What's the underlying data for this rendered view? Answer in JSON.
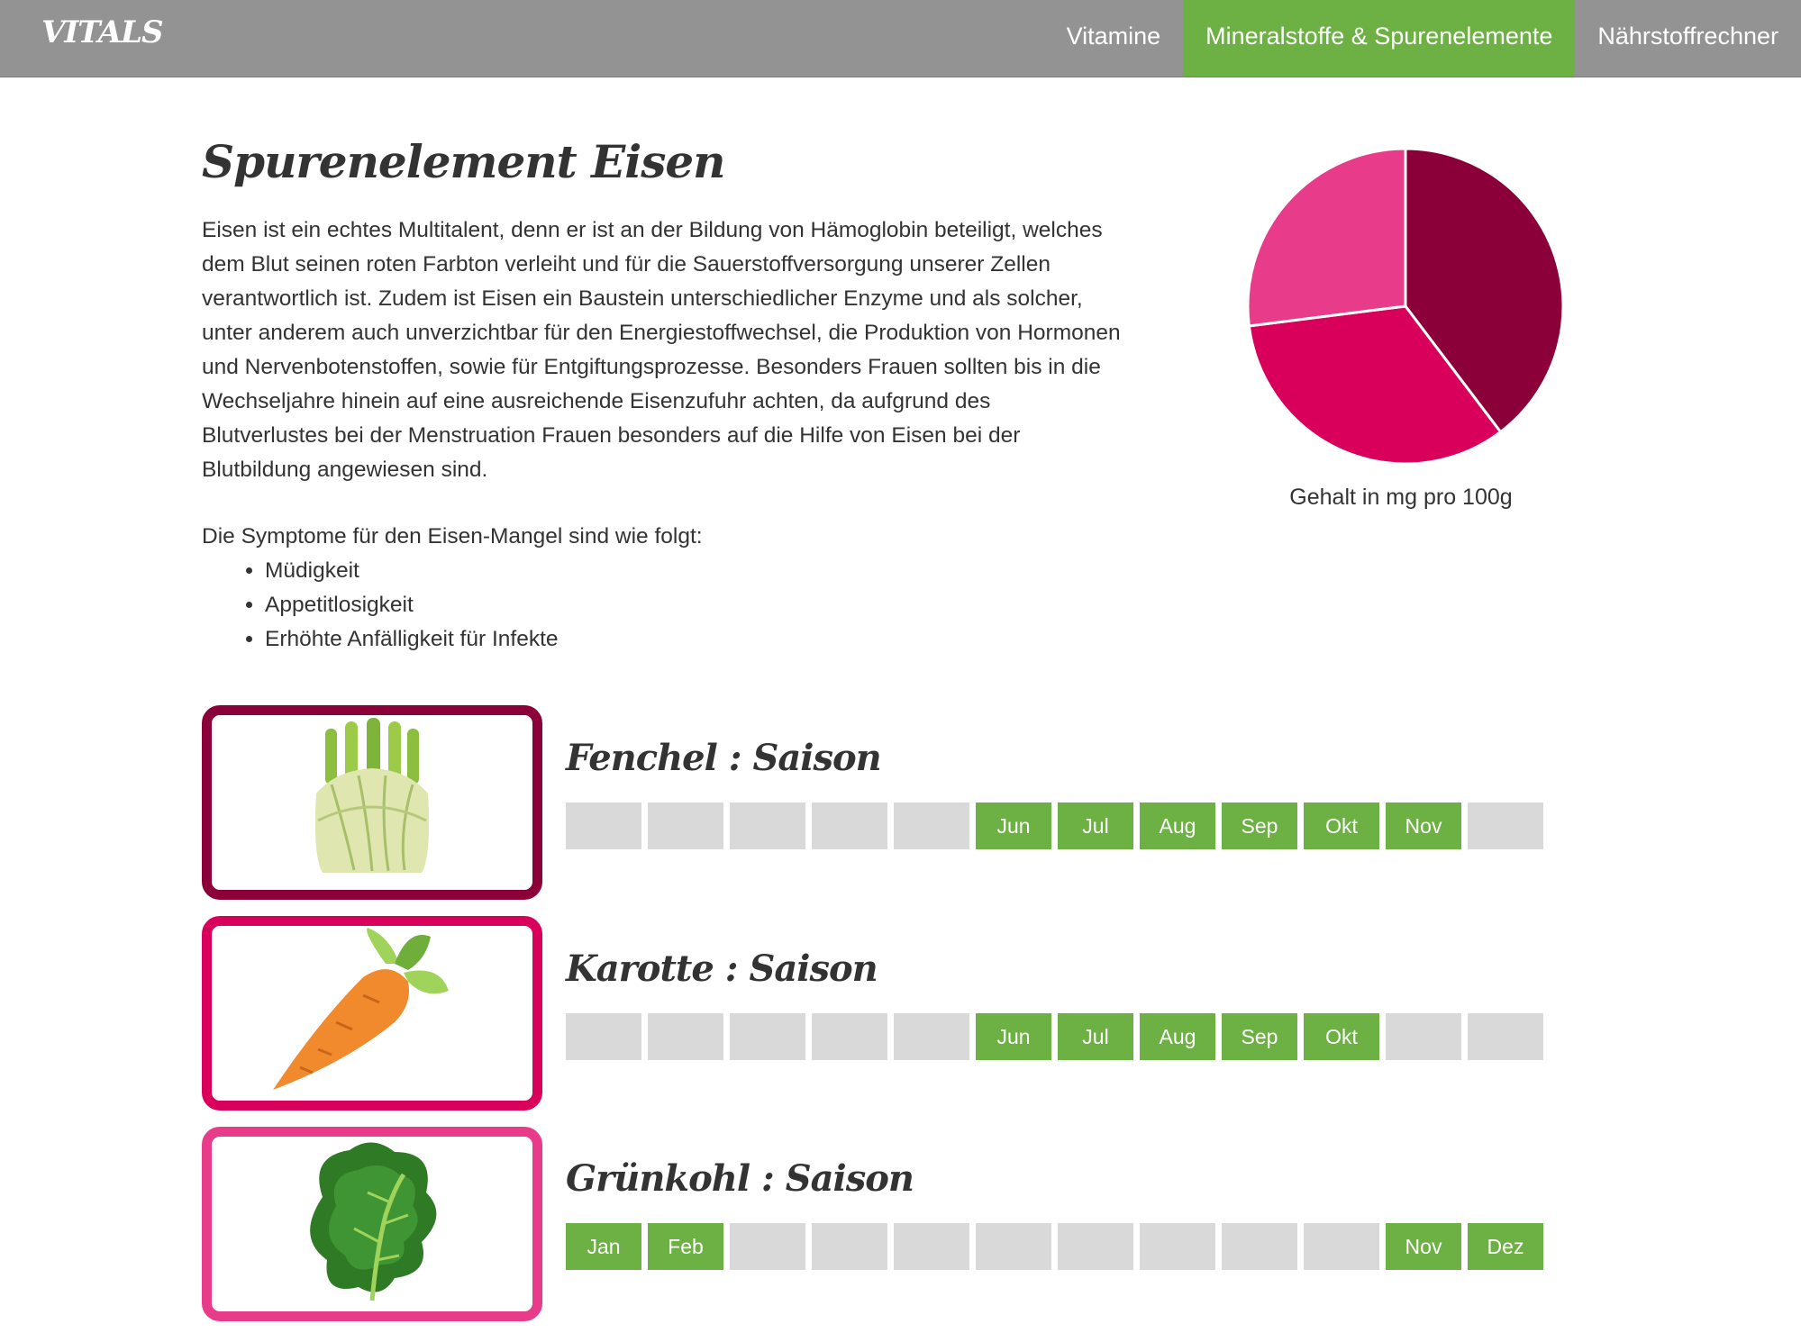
{
  "header": {
    "brand": "VITALS",
    "nav": [
      {
        "label": "Vitamine"
      },
      {
        "label": "Mineralstoffe & Spurenelemente",
        "active": true
      },
      {
        "label": "Nährstoffrechner"
      }
    ]
  },
  "page": {
    "title": "Spurenelement Eisen",
    "intro": "Eisen ist ein echtes Multitalent, denn er ist an der Bildung von Hämoglobin beteiligt, welches dem Blut seinen roten Farbton verleiht und für die Sauerstoffversorgung unserer Zellen verantwortlich ist. Zudem ist Eisen ein Baustein unterschiedlicher Enzyme und als solcher, unter anderem auch unverzichtbar für den Energiestoffwechsel, die Produktion von Hormonen und Nervenbotenstoffen, sowie für Entgiftungsprozesse. Besonders Frauen sollten bis in die Wechseljahre hinein auf eine ausreichende Eisenzufuhr achten, da aufgrund des Blutverlustes bei der Menstruation Frauen besonders auf die Hilfe von Eisen bei der Blutbildung angewiesen sind.",
    "symptoms_intro": "Die Symptome für den Eisen-Mangel sind wie folgt:",
    "symptoms": [
      "Müdigkeit",
      "Appetitlosigkeit",
      "Erhöhte Anfälligkeit für Infekte"
    ]
  },
  "chart_data": {
    "type": "pie",
    "caption": "Gehalt in mg pro 100g",
    "slices": [
      {
        "share": 0.397,
        "color": "#8b0038"
      },
      {
        "share": 0.333,
        "color": "#d8005a"
      },
      {
        "share": 0.27,
        "color": "#e83c8a"
      }
    ]
  },
  "foods": [
    {
      "name": "Fenchel",
      "title": "Fenchel : Saison",
      "color": "#8b0038",
      "icon": "fennel-icon",
      "months": [
        {
          "label": "",
          "in_season": false
        },
        {
          "label": "",
          "in_season": false
        },
        {
          "label": "",
          "in_season": false
        },
        {
          "label": "",
          "in_season": false
        },
        {
          "label": "",
          "in_season": false
        },
        {
          "label": "Jun",
          "in_season": true
        },
        {
          "label": "Jul",
          "in_season": true
        },
        {
          "label": "Aug",
          "in_season": true
        },
        {
          "label": "Sep",
          "in_season": true
        },
        {
          "label": "Okt",
          "in_season": true
        },
        {
          "label": "Nov",
          "in_season": true
        },
        {
          "label": "",
          "in_season": false
        }
      ]
    },
    {
      "name": "Karotte",
      "title": "Karotte : Saison",
      "color": "#d8005a",
      "icon": "carrot-icon",
      "months": [
        {
          "label": "",
          "in_season": false
        },
        {
          "label": "",
          "in_season": false
        },
        {
          "label": "",
          "in_season": false
        },
        {
          "label": "",
          "in_season": false
        },
        {
          "label": "",
          "in_season": false
        },
        {
          "label": "Jun",
          "in_season": true
        },
        {
          "label": "Jul",
          "in_season": true
        },
        {
          "label": "Aug",
          "in_season": true
        },
        {
          "label": "Sep",
          "in_season": true
        },
        {
          "label": "Okt",
          "in_season": true
        },
        {
          "label": "",
          "in_season": false
        },
        {
          "label": "",
          "in_season": false
        }
      ]
    },
    {
      "name": "Grünkohl",
      "title": "Grünkohl : Saison",
      "color": "#e83c8a",
      "icon": "kale-icon",
      "months": [
        {
          "label": "Jan",
          "in_season": true
        },
        {
          "label": "Feb",
          "in_season": true
        },
        {
          "label": "",
          "in_season": false
        },
        {
          "label": "",
          "in_season": false
        },
        {
          "label": "",
          "in_season": false
        },
        {
          "label": "",
          "in_season": false
        },
        {
          "label": "",
          "in_season": false
        },
        {
          "label": "",
          "in_season": false
        },
        {
          "label": "",
          "in_season": false
        },
        {
          "label": "",
          "in_season": false
        },
        {
          "label": "Nov",
          "in_season": true
        },
        {
          "label": "Dez",
          "in_season": true
        }
      ]
    }
  ]
}
